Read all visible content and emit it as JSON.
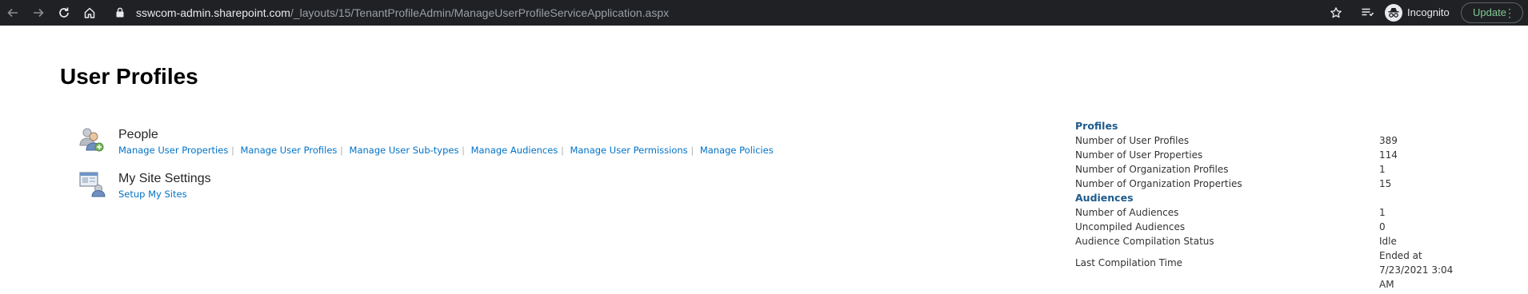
{
  "browser": {
    "url_host": "sswcom-admin.sharepoint.com",
    "url_path": "/_layouts/15/TenantProfileAdmin/ManageUserProfileServiceApplication.aspx",
    "profile_label": "Incognito",
    "update_label": "Update",
    "icons": {
      "back": "arrow-left-icon",
      "forward": "arrow-right-icon",
      "reload": "reload-icon",
      "home": "home-icon",
      "lock": "lock-icon",
      "bookmark": "star-icon",
      "reading_list": "reading-list-icon",
      "incognito": "incognito-icon",
      "menu": "more-vertical-icon"
    }
  },
  "page": {
    "title": "User Profiles"
  },
  "sections": {
    "people": {
      "title": "People",
      "icon": "people-icon",
      "links": [
        "Manage User Properties",
        "Manage User Profiles",
        "Manage User Sub-types",
        "Manage Audiences",
        "Manage User Permissions",
        "Manage Policies"
      ]
    },
    "mysite": {
      "title": "My Site Settings",
      "icon": "my-site-settings-icon",
      "links": [
        "Setup My Sites"
      ]
    }
  },
  "stats": {
    "profiles": {
      "heading": "Profiles",
      "rows": [
        {
          "label": "Number of User Profiles",
          "value": "389"
        },
        {
          "label": "Number of User Properties",
          "value": "114"
        },
        {
          "label": "Number of Organization Profiles",
          "value": "1"
        },
        {
          "label": "Number of Organization Properties",
          "value": "15"
        }
      ]
    },
    "audiences": {
      "heading": "Audiences",
      "rows": [
        {
          "label": "Number of Audiences",
          "value": "1"
        },
        {
          "label": "Uncompiled Audiences",
          "value": "0"
        },
        {
          "label": "Audience Compilation Status",
          "value": "Idle"
        },
        {
          "label": "Last Compilation Time",
          "value": "Ended at 7/23/2021 3:04 AM"
        }
      ]
    }
  },
  "colors": {
    "chrome_bg": "#202124",
    "link": "#0072c6",
    "stats_heading": "#1e5b8c",
    "update_green": "#81c995"
  }
}
